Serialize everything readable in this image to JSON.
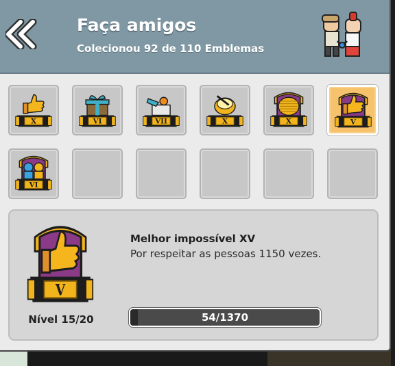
{
  "header": {
    "title": "Faça amigos",
    "subtitle": "Colecionou 92 de 110 Emblemas",
    "back_icon": "double-chevron-left-icon",
    "friends_icon": "friends-holding-hands-icon"
  },
  "badges": [
    {
      "icon": "thumbs-up-badge-icon",
      "numeral": "X",
      "selected": false,
      "empty": false
    },
    {
      "icon": "gift-box-badge-icon",
      "numeral": "VI",
      "selected": false,
      "empty": false
    },
    {
      "icon": "open-gift-badge-icon",
      "numeral": "VII",
      "selected": false,
      "empty": false
    },
    {
      "icon": "drum-badge-icon",
      "numeral": "X",
      "selected": false,
      "empty": false
    },
    {
      "icon": "gold-stack-badge-icon",
      "numeral": "X",
      "selected": false,
      "empty": false
    },
    {
      "icon": "thumbs-up-gold-badge-icon",
      "numeral": "V",
      "selected": true,
      "empty": false
    },
    {
      "icon": "friends-pair-badge-icon",
      "numeral": "VI",
      "selected": false,
      "empty": false
    },
    {
      "icon": "",
      "numeral": "",
      "selected": false,
      "empty": true
    },
    {
      "icon": "",
      "numeral": "",
      "selected": false,
      "empty": true
    },
    {
      "icon": "",
      "numeral": "",
      "selected": false,
      "empty": true
    },
    {
      "icon": "",
      "numeral": "",
      "selected": false,
      "empty": true
    },
    {
      "icon": "",
      "numeral": "",
      "selected": false,
      "empty": true
    }
  ],
  "detail": {
    "big_numeral": "V",
    "level": "Nível 15/20",
    "name": "Melhor impossível XV",
    "description": "Por respeitar as pessoas 1150 vezes.",
    "progress_text": "54/1370",
    "progress_current": 54,
    "progress_total": 1370
  },
  "colors": {
    "header": "#7f98a4",
    "panel": "#ebebeb",
    "selected_slot": "#f6c26b",
    "badge_gold": "#f2b41c",
    "badge_frame": "#1d1d1d",
    "badge_purple": "#8a3a86"
  }
}
